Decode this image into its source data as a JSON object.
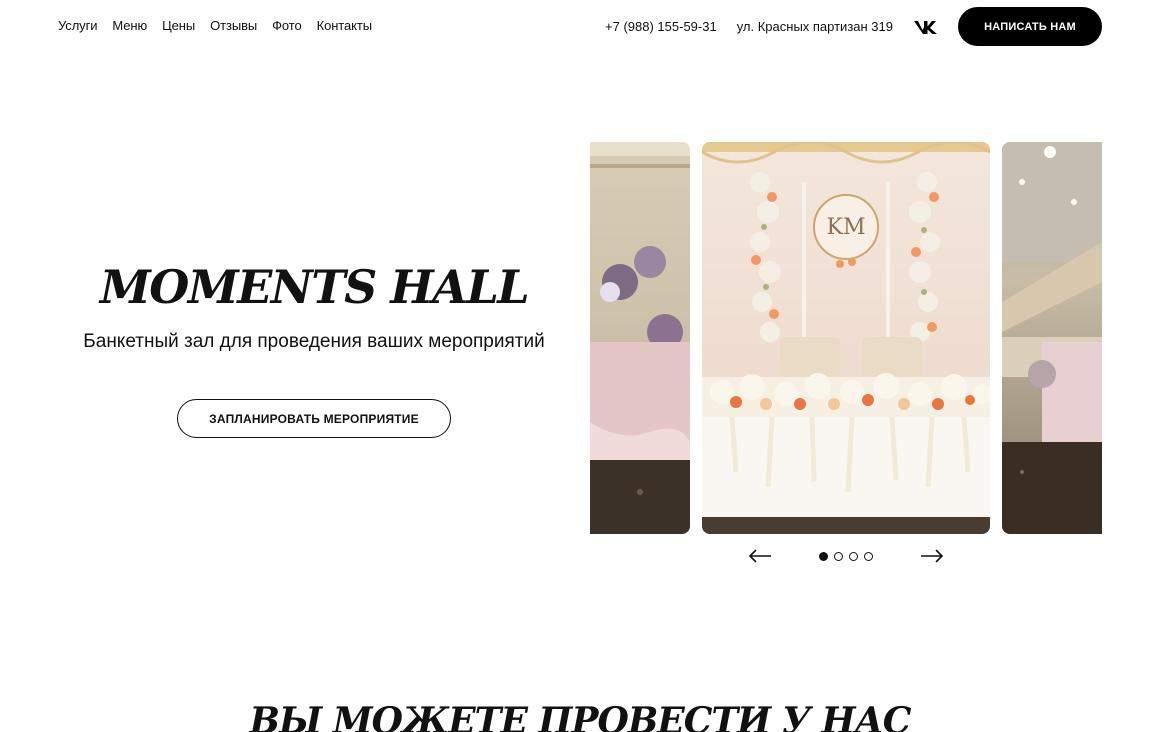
{
  "nav": {
    "items": [
      {
        "label": "Услуги"
      },
      {
        "label": "Меню"
      },
      {
        "label": "Цены"
      },
      {
        "label": "Отзывы"
      },
      {
        "label": "Фото"
      },
      {
        "label": "Контакты"
      }
    ]
  },
  "contacts": {
    "phone": "+7 (988) 155-59-31",
    "address": "ул. Красных партизан 319",
    "social_icon": "vk-icon",
    "write_button": "НАПИСАТЬ НАМ"
  },
  "hero": {
    "title": "MOMENTS HALL",
    "subtitle": "Банкетный зал для проведения ваших мероприятий",
    "cta": "ЗАПЛАНИРОВАТЬ МЕРОПРИЯТИЕ"
  },
  "gallery": {
    "slides": [
      {
        "name": "hall-side-table-photo"
      },
      {
        "name": "wedding-table-flowers-photo",
        "monogram": "KM"
      },
      {
        "name": "banquet-hall-interior-photo"
      }
    ],
    "dots": 4,
    "active_dot": 1,
    "prev_icon": "arrow-left-icon",
    "next_icon": "arrow-right-icon"
  },
  "section": {
    "title": "ВЫ МОЖЕТЕ ПРОВЕСТИ У НАС"
  },
  "colors": {
    "accent": "#000000",
    "background": "#ffffff"
  }
}
